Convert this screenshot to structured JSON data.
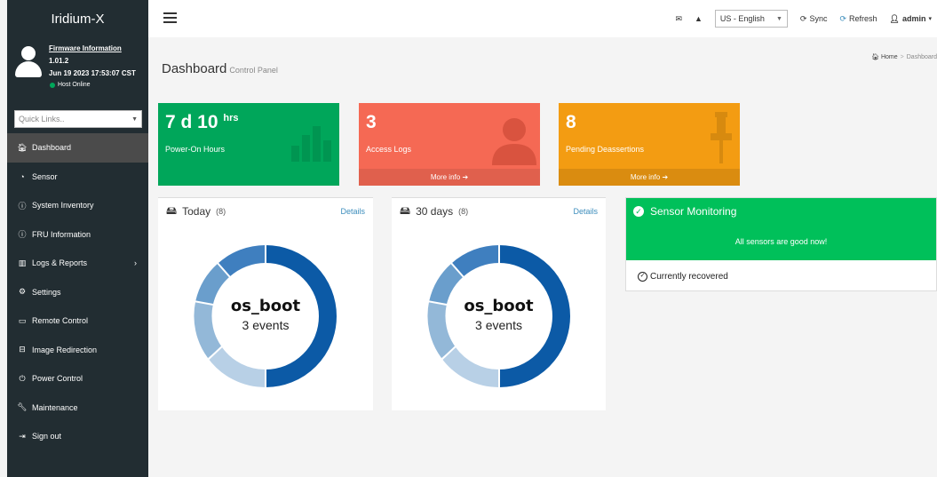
{
  "sidebar": {
    "brand": "Iridium-X",
    "firmware": {
      "title": "Firmware Information",
      "version": "1.01.2",
      "date": "Jun 19 2023 17:53:07 CST",
      "status": "Host Online"
    },
    "quick_links": "Quick Links..",
    "items": [
      {
        "label": "Dashboard",
        "icon": "home-icon"
      },
      {
        "label": "Sensor",
        "icon": "gauge-icon"
      },
      {
        "label": "System Inventory",
        "icon": "info-icon"
      },
      {
        "label": "FRU Information",
        "icon": "info-icon"
      },
      {
        "label": "Logs & Reports",
        "icon": "bar-chart-icon"
      },
      {
        "label": "Settings",
        "icon": "gear-icon"
      },
      {
        "label": "Remote Control",
        "icon": "monitor-icon"
      },
      {
        "label": "Image Redirection",
        "icon": "disk-icon"
      },
      {
        "label": "Power Control",
        "icon": "power-icon"
      },
      {
        "label": "Maintenance",
        "icon": "wrench-icon"
      },
      {
        "label": "Sign out",
        "icon": "sign-out-icon"
      }
    ]
  },
  "header": {
    "language": "US - English",
    "sync": "Sync",
    "refresh": "Refresh",
    "user": "admin"
  },
  "page": {
    "title": "Dashboard",
    "subtitle": "Control Panel",
    "breadcrumb_home": "Home",
    "breadcrumb_current": "Dashboard"
  },
  "tiles": [
    {
      "value": "7 d 10",
      "unit": "hrs",
      "label": "Power-On Hours",
      "more": ""
    },
    {
      "value": "3",
      "label": "Access Logs",
      "more": "More info"
    },
    {
      "value": "8",
      "label": "Pending Deassertions",
      "more": "More info"
    }
  ],
  "cards": [
    {
      "title": "Today",
      "count": "(8)",
      "details": "Details",
      "center_title": "os_boot",
      "center_sub": "3 events"
    },
    {
      "title": "30 days",
      "count": "(8)",
      "details": "Details",
      "center_title": "os_boot",
      "center_sub": "3 events"
    }
  ],
  "sensor": {
    "title": "Sensor Monitoring",
    "message": "All sensors are good now!",
    "recovered": "Currently recovered"
  },
  "colors": {
    "sidebar_bg": "#222d32",
    "green_tile": "#00a65a",
    "red_tile": "#f56954",
    "orange_tile": "#f39c12",
    "sensor_green": "#00c05a",
    "link_blue": "#3c8dbc"
  }
}
